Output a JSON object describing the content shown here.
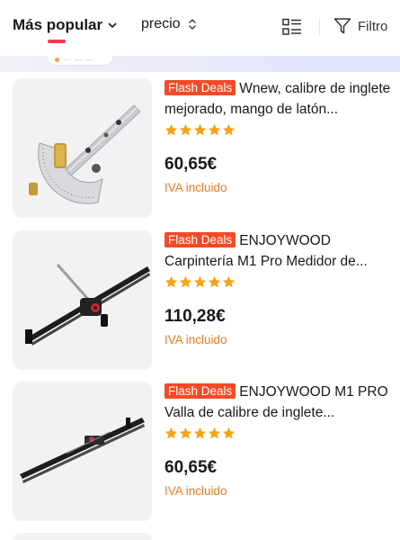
{
  "sort_bar": {
    "popular_label": "Más popular",
    "price_label": "precio",
    "filter_label": "Filtro",
    "icons": {
      "popular_dropdown": "chevron-down-icon",
      "price_sort": "sort-updown-icon",
      "view_toggle": "list-view-icon",
      "filter": "funnel-icon"
    },
    "accent_color": "#fd384f"
  },
  "products": [
    {
      "badge": "Flash Deals",
      "title": "Wnew, calibre de inglete mejorado, mango de latón...",
      "rating": 5,
      "price": "60,65€",
      "vat": "IVA incluido"
    },
    {
      "badge": "Flash Deals",
      "title": "ENJOYWOOD Carpintería M1 Pro Medidor de...",
      "rating": 5,
      "price": "110,28€",
      "vat": "IVA incluido"
    },
    {
      "badge": "Flash Deals",
      "title": "ENJOYWOOD M1 PRO Valla de calibre de inglete...",
      "rating": 5,
      "price": "60,65€",
      "vat": "IVA incluido"
    }
  ],
  "colors": {
    "flash_badge_bg": "#f54a26",
    "star": "#f7a21b",
    "vat_text": "#e87c1e"
  }
}
